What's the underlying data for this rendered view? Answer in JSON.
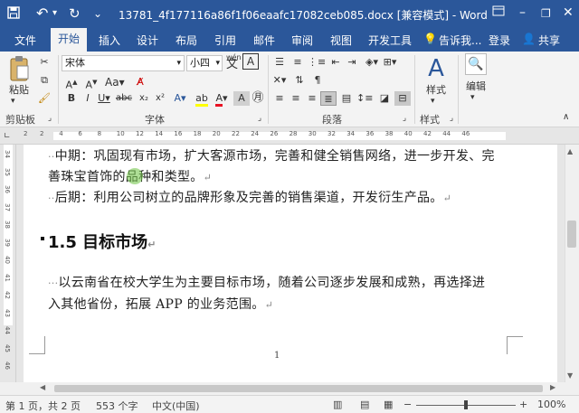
{
  "titlebar": {
    "title": "13781_4f177116a86f1f06eaafc17082ceb085.docx [兼容模式] - Word",
    "save_icon": "💾",
    "undo_icon": "↶",
    "redo_icon": "↻",
    "more_icon": "⌄"
  },
  "tabs": {
    "file": "文件",
    "home": "开始",
    "insert": "插入",
    "design": "设计",
    "layout": "布局",
    "references": "引用",
    "mailings": "邮件",
    "review": "审阅",
    "view": "视图",
    "developer": "开发工具",
    "tell_me": "告诉我...",
    "login": "登录",
    "share": "共享"
  },
  "ribbon": {
    "paste_label": "粘贴",
    "clipboard_label": "剪贴板",
    "font_label": "字体",
    "paragraph_label": "段落",
    "styles_group_label": "样式",
    "styles_button": "样式",
    "editing_button": "编辑",
    "font_name": "宋体",
    "font_size": "小四",
    "wen_label": "wén"
  },
  "ruler": {
    "ticks": [
      "2",
      "2",
      "4",
      "6",
      "8",
      "10",
      "12",
      "14",
      "16",
      "18",
      "20",
      "22",
      "24",
      "26",
      "28",
      "30",
      "32",
      "34",
      "36",
      "38",
      "40",
      "42",
      "44",
      "46"
    ],
    "vticks": [
      "34",
      "35",
      "36",
      "37",
      "38",
      "39",
      "40",
      "41",
      "42",
      "43",
      "44",
      "45",
      "46"
    ]
  },
  "document": {
    "line1": "中期：巩固现有市场，扩大客源市场，完善和健全销售网络，进一步开发、完",
    "line2": "善珠宝首饰的品种和类型。",
    "line3": "后期：利用公司树立的品牌形象及完善的销售渠道，开发衍生产品。",
    "heading": "1.5  目标市场",
    "para1": "以云南省在校大学生为主要目标市场，随着公司逐步发展和成熟，再选择进",
    "para2": "入其他省份，拓展 APP 的业务范围。",
    "page_number": "1",
    "para_mark": "↵"
  },
  "status": {
    "page": "第 1 页，共 2 页",
    "words": "553 个字",
    "language": "中文(中国)",
    "zoom": "100%"
  },
  "colors": {
    "accent": "#2b579a",
    "highlight_yellow": "#ffff00",
    "font_red": "#e81123"
  }
}
